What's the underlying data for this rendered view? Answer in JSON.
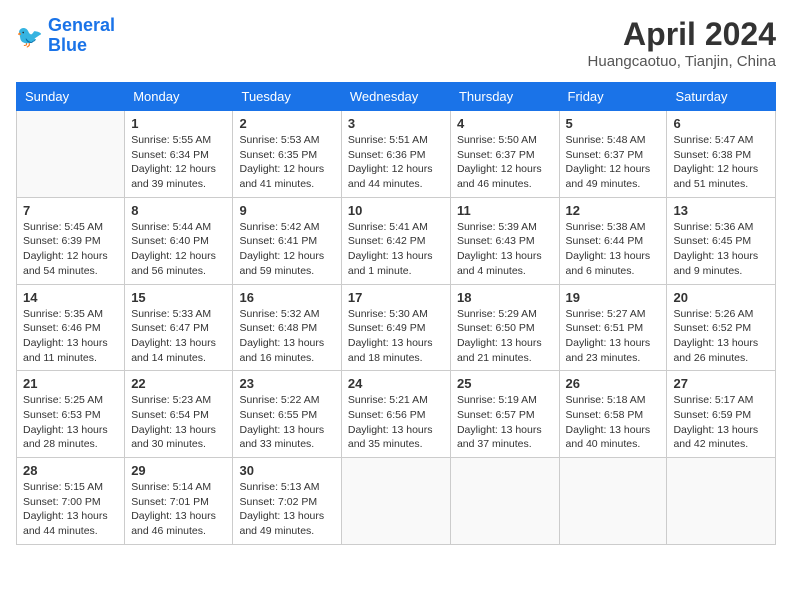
{
  "logo": {
    "line1": "General",
    "line2": "Blue"
  },
  "title": "April 2024",
  "location": "Huangcaotuo, Tianjin, China",
  "weekdays": [
    "Sunday",
    "Monday",
    "Tuesday",
    "Wednesday",
    "Thursday",
    "Friday",
    "Saturday"
  ],
  "weeks": [
    [
      {
        "day": "",
        "text": ""
      },
      {
        "day": "1",
        "text": "Sunrise: 5:55 AM\nSunset: 6:34 PM\nDaylight: 12 hours\nand 39 minutes."
      },
      {
        "day": "2",
        "text": "Sunrise: 5:53 AM\nSunset: 6:35 PM\nDaylight: 12 hours\nand 41 minutes."
      },
      {
        "day": "3",
        "text": "Sunrise: 5:51 AM\nSunset: 6:36 PM\nDaylight: 12 hours\nand 44 minutes."
      },
      {
        "day": "4",
        "text": "Sunrise: 5:50 AM\nSunset: 6:37 PM\nDaylight: 12 hours\nand 46 minutes."
      },
      {
        "day": "5",
        "text": "Sunrise: 5:48 AM\nSunset: 6:37 PM\nDaylight: 12 hours\nand 49 minutes."
      },
      {
        "day": "6",
        "text": "Sunrise: 5:47 AM\nSunset: 6:38 PM\nDaylight: 12 hours\nand 51 minutes."
      }
    ],
    [
      {
        "day": "7",
        "text": "Sunrise: 5:45 AM\nSunset: 6:39 PM\nDaylight: 12 hours\nand 54 minutes."
      },
      {
        "day": "8",
        "text": "Sunrise: 5:44 AM\nSunset: 6:40 PM\nDaylight: 12 hours\nand 56 minutes."
      },
      {
        "day": "9",
        "text": "Sunrise: 5:42 AM\nSunset: 6:41 PM\nDaylight: 12 hours\nand 59 minutes."
      },
      {
        "day": "10",
        "text": "Sunrise: 5:41 AM\nSunset: 6:42 PM\nDaylight: 13 hours\nand 1 minute."
      },
      {
        "day": "11",
        "text": "Sunrise: 5:39 AM\nSunset: 6:43 PM\nDaylight: 13 hours\nand 4 minutes."
      },
      {
        "day": "12",
        "text": "Sunrise: 5:38 AM\nSunset: 6:44 PM\nDaylight: 13 hours\nand 6 minutes."
      },
      {
        "day": "13",
        "text": "Sunrise: 5:36 AM\nSunset: 6:45 PM\nDaylight: 13 hours\nand 9 minutes."
      }
    ],
    [
      {
        "day": "14",
        "text": "Sunrise: 5:35 AM\nSunset: 6:46 PM\nDaylight: 13 hours\nand 11 minutes."
      },
      {
        "day": "15",
        "text": "Sunrise: 5:33 AM\nSunset: 6:47 PM\nDaylight: 13 hours\nand 14 minutes."
      },
      {
        "day": "16",
        "text": "Sunrise: 5:32 AM\nSunset: 6:48 PM\nDaylight: 13 hours\nand 16 minutes."
      },
      {
        "day": "17",
        "text": "Sunrise: 5:30 AM\nSunset: 6:49 PM\nDaylight: 13 hours\nand 18 minutes."
      },
      {
        "day": "18",
        "text": "Sunrise: 5:29 AM\nSunset: 6:50 PM\nDaylight: 13 hours\nand 21 minutes."
      },
      {
        "day": "19",
        "text": "Sunrise: 5:27 AM\nSunset: 6:51 PM\nDaylight: 13 hours\nand 23 minutes."
      },
      {
        "day": "20",
        "text": "Sunrise: 5:26 AM\nSunset: 6:52 PM\nDaylight: 13 hours\nand 26 minutes."
      }
    ],
    [
      {
        "day": "21",
        "text": "Sunrise: 5:25 AM\nSunset: 6:53 PM\nDaylight: 13 hours\nand 28 minutes."
      },
      {
        "day": "22",
        "text": "Sunrise: 5:23 AM\nSunset: 6:54 PM\nDaylight: 13 hours\nand 30 minutes."
      },
      {
        "day": "23",
        "text": "Sunrise: 5:22 AM\nSunset: 6:55 PM\nDaylight: 13 hours\nand 33 minutes."
      },
      {
        "day": "24",
        "text": "Sunrise: 5:21 AM\nSunset: 6:56 PM\nDaylight: 13 hours\nand 35 minutes."
      },
      {
        "day": "25",
        "text": "Sunrise: 5:19 AM\nSunset: 6:57 PM\nDaylight: 13 hours\nand 37 minutes."
      },
      {
        "day": "26",
        "text": "Sunrise: 5:18 AM\nSunset: 6:58 PM\nDaylight: 13 hours\nand 40 minutes."
      },
      {
        "day": "27",
        "text": "Sunrise: 5:17 AM\nSunset: 6:59 PM\nDaylight: 13 hours\nand 42 minutes."
      }
    ],
    [
      {
        "day": "28",
        "text": "Sunrise: 5:15 AM\nSunset: 7:00 PM\nDaylight: 13 hours\nand 44 minutes."
      },
      {
        "day": "29",
        "text": "Sunrise: 5:14 AM\nSunset: 7:01 PM\nDaylight: 13 hours\nand 46 minutes."
      },
      {
        "day": "30",
        "text": "Sunrise: 5:13 AM\nSunset: 7:02 PM\nDaylight: 13 hours\nand 49 minutes."
      },
      {
        "day": "",
        "text": ""
      },
      {
        "day": "",
        "text": ""
      },
      {
        "day": "",
        "text": ""
      },
      {
        "day": "",
        "text": ""
      }
    ]
  ]
}
